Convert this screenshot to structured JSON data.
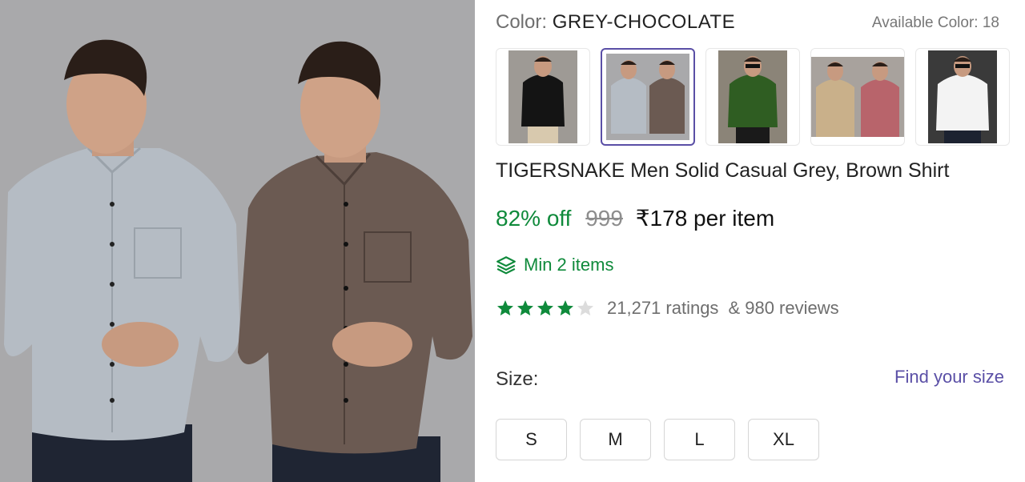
{
  "product": {
    "color_label": "Color:",
    "color_value": "GREY-CHOCOLATE",
    "available_colors": "Available Color: 18",
    "title": "TIGERSNAKE Men Solid Casual Grey, Brown Shirt",
    "discount": "82% off",
    "mrp": "999",
    "price": "₹178 per item",
    "min_order": "Min 2 items",
    "rating": 4,
    "ratings_count": "21,271 ratings",
    "reviews_count": "& 980 reviews",
    "size_label": "Size:",
    "find_size": "Find your size",
    "sizes": [
      "S",
      "M",
      "L",
      "XL"
    ]
  },
  "thumbnails": [
    {
      "name": "black shirt",
      "shirt": "#141414",
      "selected": false
    },
    {
      "name": "grey and chocolate shirts",
      "shirt": "#a9a9ab",
      "selected": true
    },
    {
      "name": "green shirt",
      "shirt": "#2f5d22",
      "selected": false
    },
    {
      "name": "beige and maroon shirts",
      "shirt": "#c9b08a",
      "selected": false
    },
    {
      "name": "white shirt",
      "shirt": "#f3f3f3",
      "selected": false
    }
  ],
  "colors": {
    "accent": "#5a4fa6",
    "discount_green": "#0f8a3b",
    "star_green": "#0f8a3b",
    "star_empty": "#dcdcdc",
    "photo_bg": "#a9a9ab",
    "grey_shirt": "#b5bcc4",
    "brown_shirt": "#6b5a52"
  }
}
